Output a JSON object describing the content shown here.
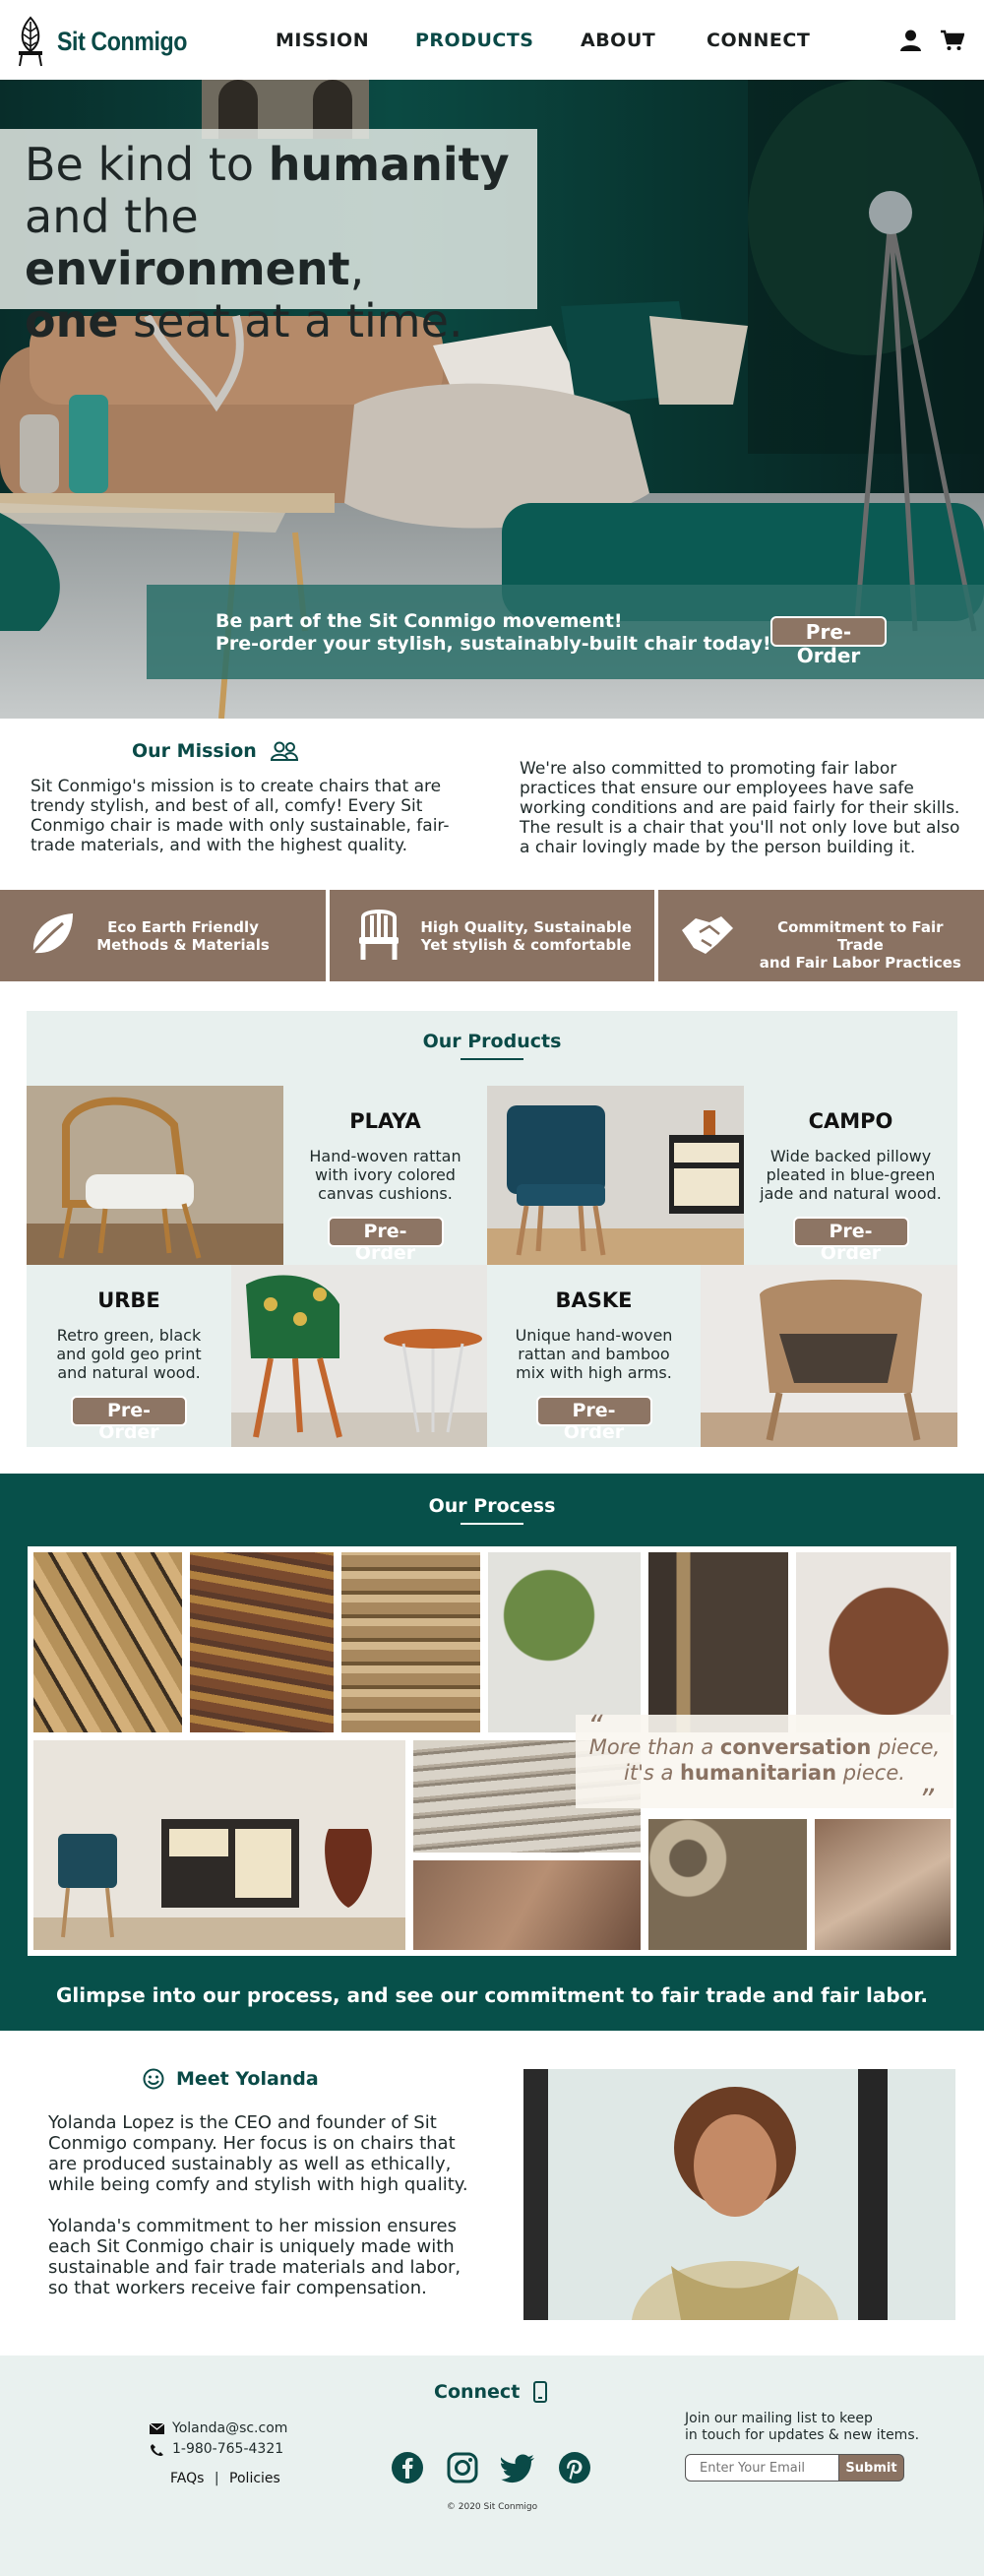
{
  "brand": {
    "name": "Sit Conmigo",
    "primary_color": "#0a4a47",
    "accent_color": "#8a7262"
  },
  "nav": {
    "items": [
      "MISSION",
      "PRODUCTS",
      "ABOUT",
      "CONNECT"
    ],
    "active": "PRODUCTS"
  },
  "header_icons": [
    "user-icon",
    "cart-icon"
  ],
  "hero": {
    "title_line1_pre": "Be kind to ",
    "title_line1_bold": "humanity",
    "title_line2_pre": "and the ",
    "title_line2_bold": "environment",
    "title_line2_post": ",",
    "title_line3_bold": "one",
    "title_line3_post": " seat at a time.",
    "banner_line1": "Be part of the Sit Conmigo movement!",
    "banner_line2": "Pre-order your stylish, sustainably-built chair today!",
    "cta": "Pre-Order"
  },
  "mission": {
    "title": "Our Mission",
    "left": "Sit Conmigo's mission is to create chairs that are trendy stylish, and best of all, comfy! Every Sit Conmigo chair is made with only sustainable, fair-trade materials, and with the highest quality.",
    "right": "We're also committed to promoting fair labor practices that ensure our employees have safe working conditions and are paid fairly for their skills. The result is a chair that you'll not only love but also a chair lovingly made by the person building it."
  },
  "features": [
    {
      "line1": "Eco Earth Friendly",
      "line2": "Methods & Materials",
      "icon": "leaf-icon"
    },
    {
      "line1": "High Quality, Sustainable",
      "line2": "Yet stylish & comfortable",
      "icon": "chair-icon"
    },
    {
      "line1": "Commitment to Fair Trade",
      "line2": "and Fair Labor Practices",
      "icon": "handshake-icon"
    }
  ],
  "products": {
    "title": "Our Products",
    "items": [
      {
        "name": "PLAYA",
        "desc": "Hand-woven rattan with ivory colored canvas cushions.",
        "cta": "Pre-Order"
      },
      {
        "name": "CAMPO",
        "desc": "Wide backed pillowy pleated in blue-green jade and natural wood.",
        "cta": "Pre-Order"
      },
      {
        "name": "URBE",
        "desc": "Retro green, black and gold geo print and natural wood.",
        "cta": "Pre-Order"
      },
      {
        "name": "BASKE",
        "desc": "Unique hand-woven rattan and bamboo mix with high arms.",
        "cta": "Pre-Order"
      }
    ]
  },
  "process": {
    "title": "Our Process",
    "quote_pre": "More than a ",
    "quote_bold1": "conversation",
    "quote_mid": " piece,",
    "quote_pre2": "it's a ",
    "quote_bold2": "humanitarian",
    "quote_post": " piece.",
    "caption": "Glimpse into our process, and see our commitment to fair trade and fair labor."
  },
  "yolanda": {
    "title": "Meet Yolanda",
    "p1": "Yolanda Lopez is the CEO and founder of Sit Conmigo company. Her focus is on chairs that are produced sustainably as well as ethically, while being comfy and stylish with high quality.",
    "p2": "Yolanda's commitment to her mission ensures each Sit Conmigo chair is uniquely made with sustainable and fair trade materials and labor, so that workers receive fair compensation."
  },
  "footer": {
    "title": "Connect",
    "email": "Yolanda@sc.com",
    "phone": "1-980-765-4321",
    "faqs": "FAQs",
    "sep": "|",
    "policies": "Policies",
    "mailing_line1": "Join our mailing list to keep",
    "mailing_line2": "in touch for updates & new items.",
    "email_placeholder": "Enter Your Email",
    "submit": "Submit",
    "copyright": "© 2020 Sit Conmigo",
    "social": [
      "facebook-icon",
      "instagram-icon",
      "twitter-icon",
      "pinterest-icon"
    ]
  }
}
